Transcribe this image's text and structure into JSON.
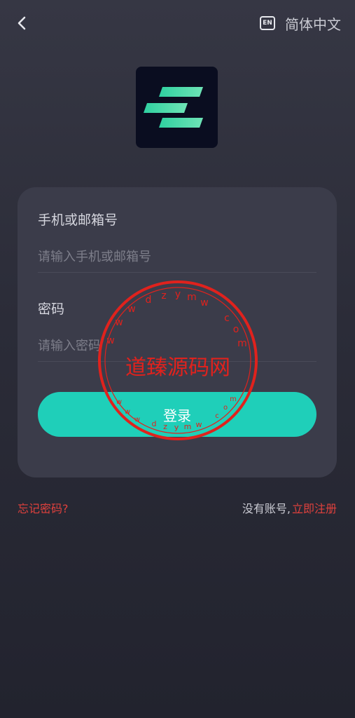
{
  "header": {
    "back_icon": "chevron-left-icon",
    "lang_icon_text": "EN",
    "lang_label": "简体中文"
  },
  "logo": {
    "icon": "app-logo-icon",
    "background": "#0a0d20",
    "accent": "#3ed8a6"
  },
  "form": {
    "account_label": "手机或邮箱号",
    "account_placeholder": "请输入手机或邮箱号",
    "password_label": "密码",
    "password_placeholder": "请输入密码",
    "login_label": "登录"
  },
  "footer": {
    "forgot_label": "忘记密码?",
    "register_prompt": "没有账号,",
    "register_label": "立即注册"
  },
  "watermark": {
    "title": "道臻源码网",
    "ring_text": "www.dzymw.com",
    "color": "#e0221d"
  },
  "colors": {
    "primary": "#1fcfb9",
    "link": "#e0413d",
    "card": "#3b3c4a"
  }
}
